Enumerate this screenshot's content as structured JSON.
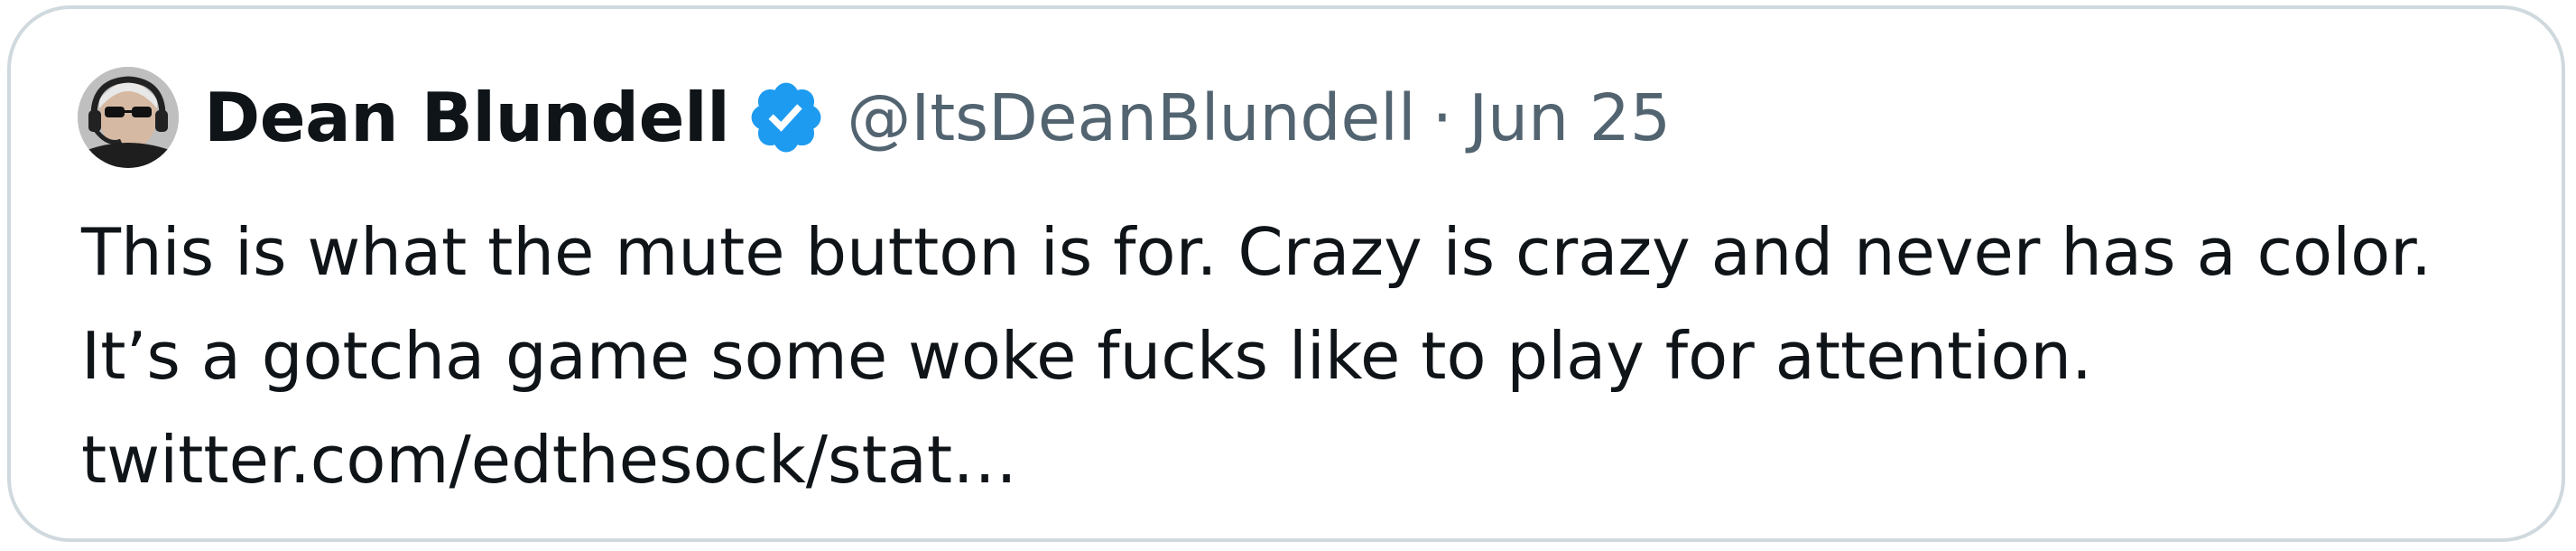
{
  "tweet": {
    "author": {
      "name": "Dean Blundell",
      "handle": "@ItsDeanBlundell",
      "verified": true,
      "avatar_icon": "avatar-person-with-headphones-sunglasses"
    },
    "separator": "·",
    "date": "Jun 25",
    "text_lines": [
      "This is what the mute button is for. Crazy is crazy and never has a color.",
      "It’s a gotcha game some woke fucks like to play for attention.",
      "twitter.com/edthesock/stat…"
    ]
  },
  "colors": {
    "text_primary": "#0f1419",
    "text_secondary": "#536471",
    "verified_blue": "#1d9bf0",
    "card_border": "#cfd9de",
    "background": "#ffffff"
  }
}
